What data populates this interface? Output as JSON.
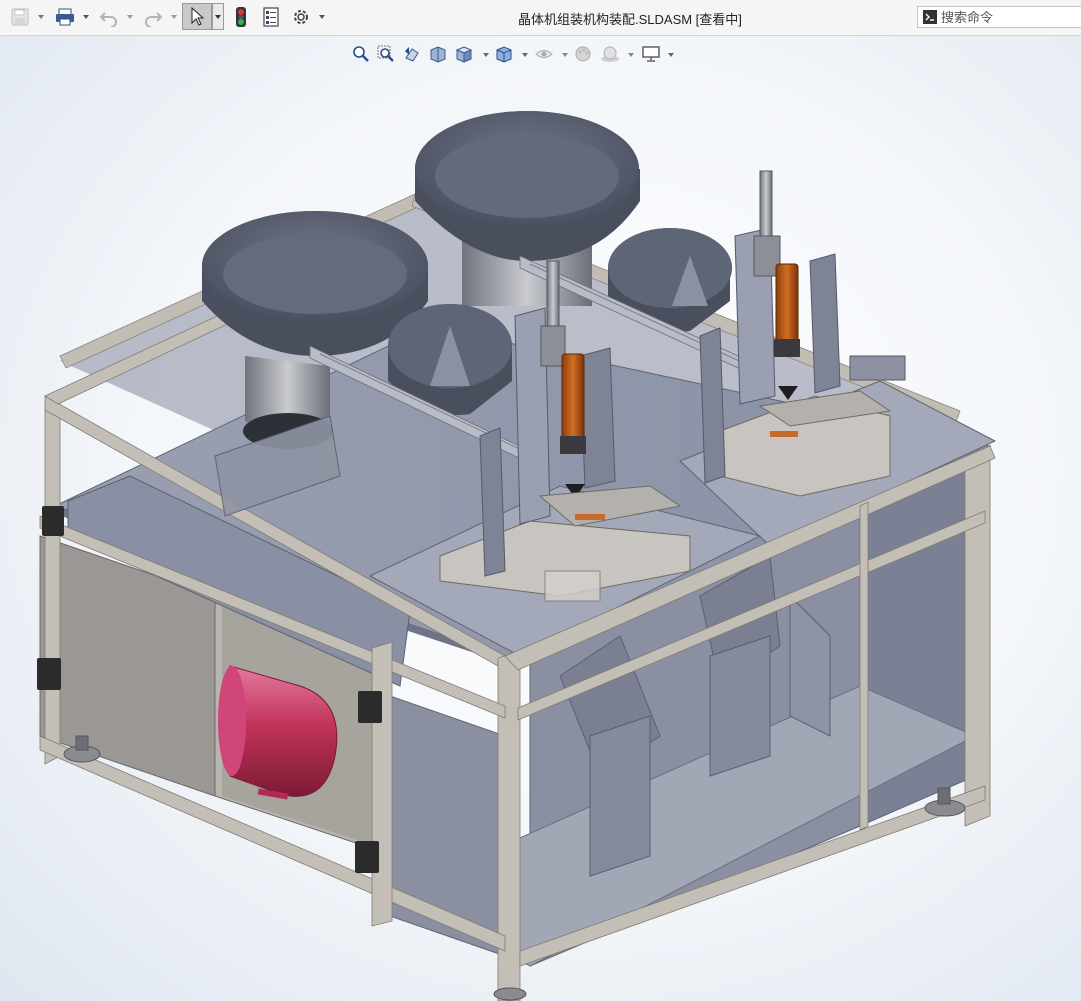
{
  "window": {
    "title": "晶体机组装机构装配.SLDASM [查看中]"
  },
  "toolbar": {
    "items": [
      {
        "name": "save-icon",
        "interactable": true
      },
      {
        "name": "print-icon",
        "interactable": true
      },
      {
        "name": "undo-icon",
        "interactable": true
      },
      {
        "name": "redo-icon",
        "interactable": true
      },
      {
        "name": "select-pointer-icon",
        "interactable": true,
        "selected": true
      },
      {
        "name": "traffic-light-rebuild-icon",
        "interactable": true
      },
      {
        "name": "file-properties-icon",
        "interactable": true
      },
      {
        "name": "options-gear-icon",
        "interactable": true
      }
    ]
  },
  "search": {
    "placeholder": "搜索命令"
  },
  "heads_up_toolbar": {
    "items": [
      "zoom-to-fit-icon",
      "zoom-to-area-icon",
      "previous-view-icon",
      "section-view-icon",
      "view-orientation-icon",
      "display-style-icon",
      "hide-show-items-icon",
      "edit-appearance-icon",
      "apply-scene-icon",
      "view-settings-icon"
    ]
  },
  "colors": {
    "frame": "#bdb8b0",
    "panel": "#8e94a6",
    "bowl": "#5e6474",
    "cylinder_orange": "#c7641c",
    "tank": "#c2335a",
    "accent_select": "#c9c9c9"
  },
  "model": {
    "name": "assembly-3d-model"
  }
}
